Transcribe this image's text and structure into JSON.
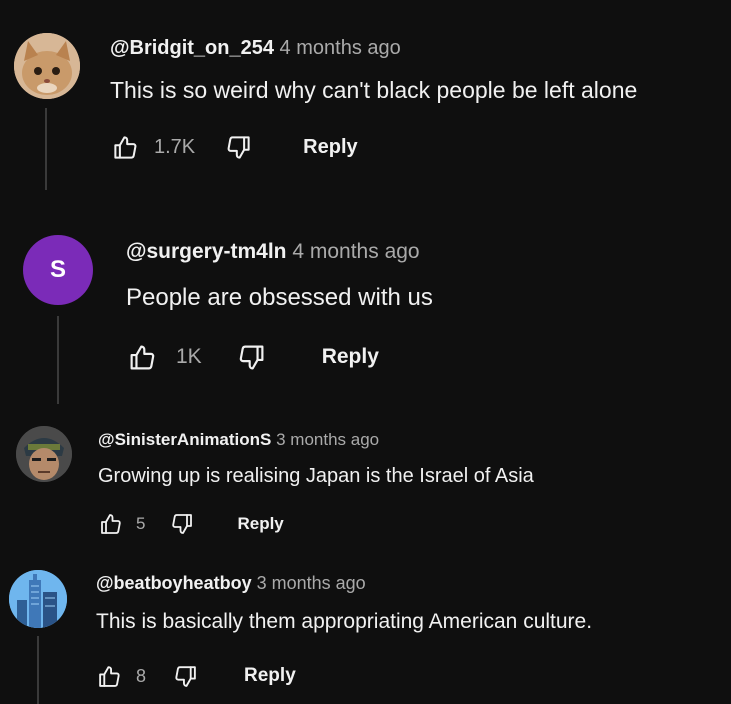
{
  "comments": [
    {
      "author": "@Bridgit_on_254",
      "time": "4 months ago",
      "text": "This is so weird why can't black people be left alone",
      "likes": "1.7K",
      "reply_label": "Reply",
      "avatar": {
        "kind": "photo",
        "subject": "cat"
      }
    },
    {
      "author": "@surgery-tm4ln",
      "time": "4 months ago",
      "text": "People are obsessed with us",
      "likes": "1K",
      "reply_label": "Reply",
      "avatar": {
        "kind": "letter",
        "letter": "S",
        "color": "#7b2bb8"
      }
    },
    {
      "author": "@SinisterAnimationS",
      "time": "3 months ago",
      "text": "Growing up is realising Japan is the Israel of Asia",
      "likes": "5",
      "reply_label": "Reply",
      "avatar": {
        "kind": "photo",
        "subject": "anime-character"
      }
    },
    {
      "author": "@beatboyheatboy",
      "time": "3 months ago",
      "text": "This is basically them appropriating American culture.",
      "likes": "8",
      "reply_label": "Reply",
      "avatar": {
        "kind": "photo",
        "subject": "skyscraper"
      }
    }
  ],
  "icons": {
    "like": "thumbs-up-icon",
    "dislike": "thumbs-down-icon"
  },
  "colors": {
    "background": "#0f0f0f",
    "text": "#f1f1f1",
    "secondary_text": "#aaaaaa"
  }
}
